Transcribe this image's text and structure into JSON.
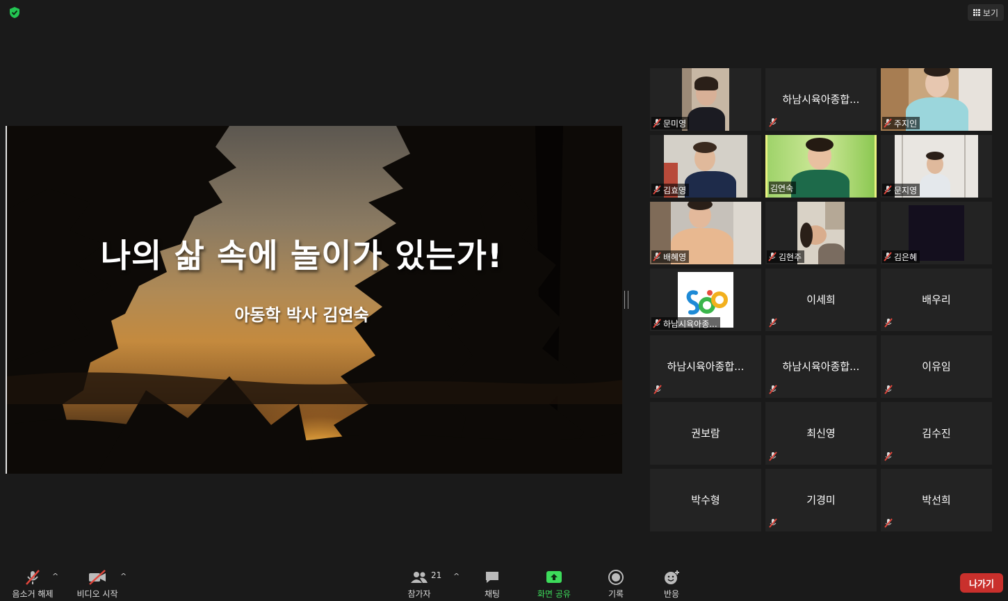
{
  "window": {
    "view_label": "보기",
    "security_icon": "shield-check-icon"
  },
  "presentation": {
    "title": "나의 삶 속에 놀이가 있는가!",
    "subtitle": "아동학 박사 김연숙"
  },
  "participants": [
    {
      "name": "문미영",
      "video": true,
      "muted": true
    },
    {
      "name": "하남시육아종합...",
      "video": false,
      "muted": true
    },
    {
      "name": "주지인",
      "video": true,
      "muted": true
    },
    {
      "name": "김효영",
      "video": true,
      "muted": true
    },
    {
      "name": "김연숙",
      "video": true,
      "muted": false,
      "active_speaker": true
    },
    {
      "name": "문지영",
      "video": true,
      "muted": true
    },
    {
      "name": "배혜영",
      "video": true,
      "muted": true
    },
    {
      "name": "김현주",
      "video": true,
      "muted": true
    },
    {
      "name": "김은혜",
      "video": true,
      "muted": true
    },
    {
      "name": "하남시육아종...",
      "video": true,
      "muted": true,
      "logo": true
    },
    {
      "name": "이세희",
      "video": false,
      "muted": true
    },
    {
      "name": "배우리",
      "video": false,
      "muted": true
    },
    {
      "name": "하남시육아종합...",
      "video": false,
      "muted": true
    },
    {
      "name": "하남시육아종합...",
      "video": false,
      "muted": true
    },
    {
      "name": "이유임",
      "video": false,
      "muted": true
    },
    {
      "name": "권보람",
      "video": false,
      "muted": false
    },
    {
      "name": "최신영",
      "video": false,
      "muted": true
    },
    {
      "name": "김수진",
      "video": false,
      "muted": true
    },
    {
      "name": "박수형",
      "video": false,
      "muted": false
    },
    {
      "name": "기경미",
      "video": false,
      "muted": true
    },
    {
      "name": "박선희",
      "video": false,
      "muted": true
    }
  ],
  "toolbar": {
    "audio_label": "음소거 해제",
    "video_label": "비디오 시작",
    "participants_label": "참가자",
    "participants_count": "21",
    "chat_label": "채팅",
    "share_label": "화면 공유",
    "record_label": "기록",
    "reactions_label": "반응",
    "leave_label": "나가기"
  },
  "colors": {
    "share_green": "#3ddc5b",
    "leave_red": "#c9302c",
    "active_speaker": "#e9f280",
    "muted_red": "#e0463c"
  }
}
